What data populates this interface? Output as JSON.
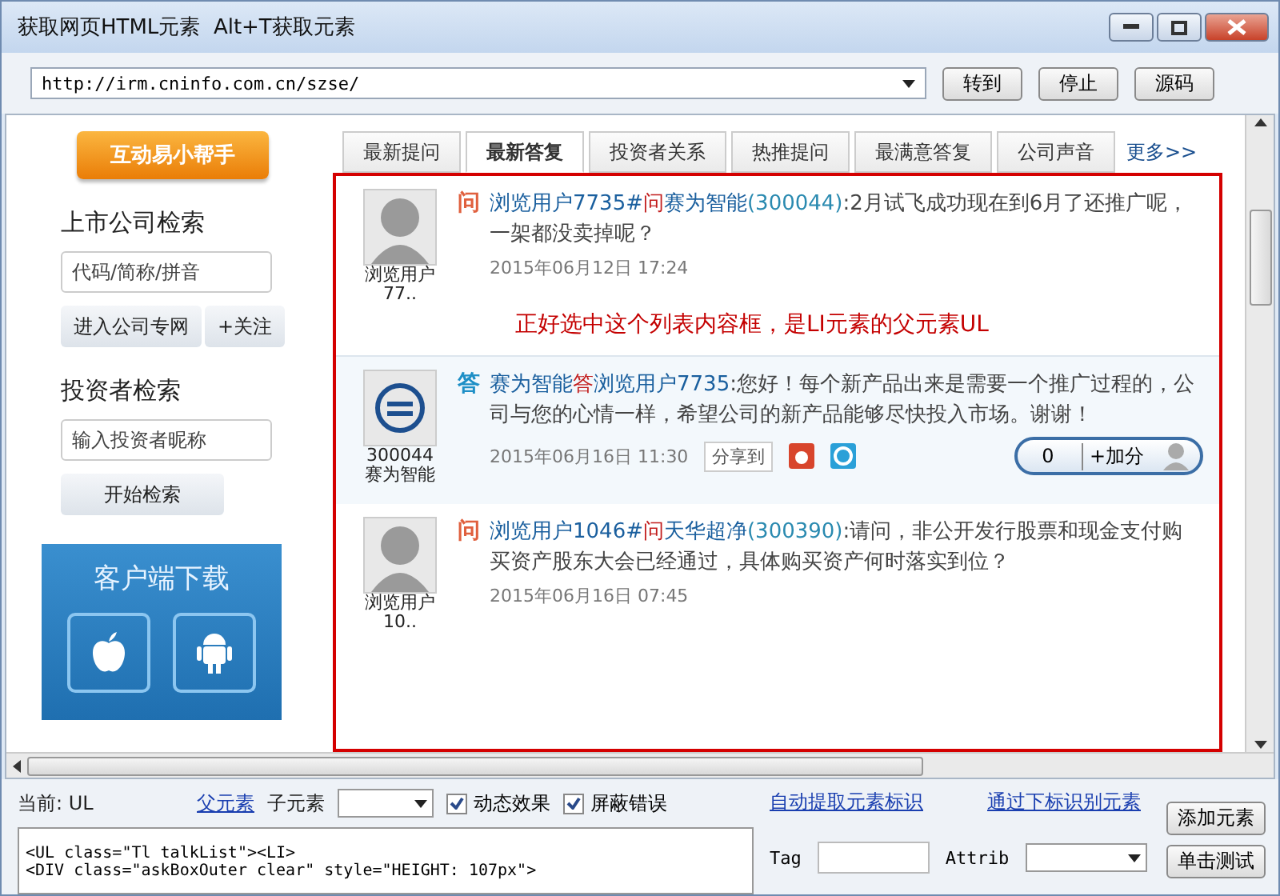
{
  "window": {
    "title": "获取网页HTML元素  Alt+T获取元素"
  },
  "address_bar": {
    "value": "http://irm.cninfo.com.cn/szse/",
    "buttons": [
      "转到",
      "停止",
      "源码"
    ]
  },
  "sidebar": {
    "helper_button": "互动易小帮手",
    "company_search": {
      "heading": "上市公司检索",
      "placeholder": "代码/简称/拼音",
      "buttons": [
        "进入公司专网",
        "+关注"
      ]
    },
    "investor_search": {
      "heading": "投资者检索",
      "placeholder": "输入投资者昵称",
      "button": "开始检索"
    },
    "download_banner": {
      "title": "客户端下载"
    }
  },
  "tabs": [
    {
      "label": "最新提问",
      "selected": false
    },
    {
      "label": "最新答复",
      "selected": true
    },
    {
      "label": "投资者关系",
      "selected": false
    },
    {
      "label": "热推提问",
      "selected": false
    },
    {
      "label": "最满意答复",
      "selected": false
    },
    {
      "label": "公司声音",
      "selected": false
    }
  ],
  "more_link": "更多>>",
  "posts": [
    {
      "kind": "question",
      "avatar_caption": "浏览用户\n77..",
      "badge": "问",
      "user": "浏览用户7735#",
      "verb": "问",
      "company": "赛为智能",
      "code": "(300044)",
      "text": ":2月试飞成功现在到6月了还推广呢，一架都没卖掉呢？",
      "time": "2015年06月12日  17:24"
    },
    {
      "kind": "note",
      "text": "正好选中这个列表内容框，是LI元素的父元素UL"
    },
    {
      "kind": "answer",
      "avatar_caption": "300044\n赛为智能",
      "badge": "答",
      "user": "赛为智能",
      "verb": "答",
      "company": "浏览用户7735",
      "text": ":您好！每个新产品出来是需要一个推广过程的，公司与您的心情一样，希望公司的新产品能够尽快投入市场。谢谢！",
      "time": "2015年06月16日  11:30",
      "share": "分享到",
      "score": "0",
      "add": "+加分"
    },
    {
      "kind": "question",
      "avatar_caption": "浏览用户\n10..",
      "badge": "问",
      "user": "浏览用户1046#",
      "verb": "问",
      "company": "天华超净",
      "code": "(300390)",
      "text": ":请问，非公开发行股票和现金支付购买资产股东大会已经通过，具体购买资产何时落实到位？",
      "time": "2015年06月16日  07:45"
    }
  ],
  "inspector": {
    "current": "当前: UL",
    "parent_link": "父元素",
    "child_label": "子元素",
    "options": [
      {
        "label": "动态效果",
        "checked": true
      },
      {
        "label": "屏蔽错误",
        "checked": true
      }
    ],
    "links": [
      "自动提取元素标识",
      "通过下标识别元素"
    ],
    "source_lines": [
      "<UL class=\"Tl talkList\"><LI>",
      "<DIV class=\"askBoxOuter clear\" style=\"HEIGHT: 107px\">"
    ],
    "field_labels": [
      "Tag",
      "Attrib"
    ],
    "buttons": [
      "添加元素",
      "单击测试"
    ]
  }
}
